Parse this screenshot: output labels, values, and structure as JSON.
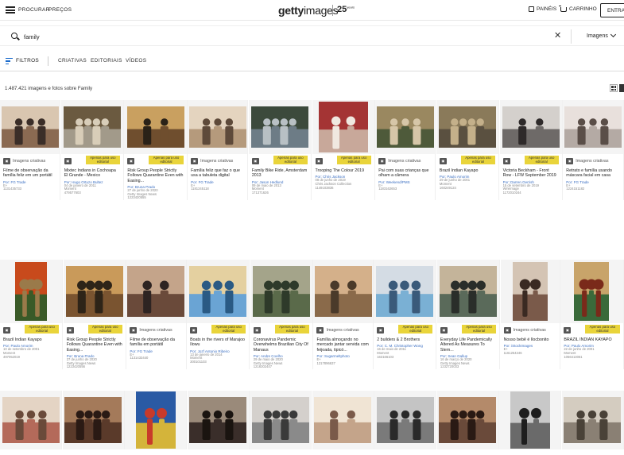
{
  "topbar": {
    "nav": [
      "PROCURAR",
      "PREÇOS"
    ],
    "logo_bold": "getty",
    "logo_thin": "images",
    "anniversary": "25",
    "anniversary_small": "years",
    "boards": "PAINÉIS",
    "cart": "CARRINHO",
    "login": "ENTRAR"
  },
  "search": {
    "value": "family",
    "type": "Imagens"
  },
  "filters": {
    "label": "FILTROS",
    "tabs": [
      "CRIATIVAS",
      "EDITORIAIS",
      "VÍDEOS"
    ]
  },
  "results": "1.487.421 imagens e fotos sobre Family",
  "badge_editorial": "Apenas para uso editorial",
  "badge_creative": "Imagens criativas",
  "cards_row1": [
    {
      "type": "creative",
      "title": "Filme de observação da família feliz em um portátil",
      "by": "Por: FG Trade",
      "meta": [
        "E+",
        "1131435733"
      ],
      "colors": [
        "#8a6a52",
        "#d9c6b0",
        "#3b2e28"
      ]
    },
    {
      "type": "editorial",
      "title": "Mixtec Indians in Cochoapa El Grande - Mexico",
      "by": "Por: Hugo Ortuzo Bultez",
      "meta": [
        "04 de janeiro de 2011",
        "Moment",
        "479577603"
      ],
      "colors": [
        "#a29a8a",
        "#6b5a40",
        "#d8cdb8"
      ]
    },
    {
      "type": "editorial",
      "title": "Risk Group People Strictly Follows Quarantine Even with Easing...",
      "by": "Por: Bruna Prado",
      "meta": [
        "27 de junho de 2020",
        "Getty Images News",
        "1223420555"
      ],
      "colors": [
        "#6f4e2e",
        "#c9a060",
        "#2a2218"
      ]
    },
    {
      "type": "creative",
      "title": "Família feliz que faz o que usa a tabuleta digital",
      "by": "Por: FG Trade",
      "meta": [
        "E+",
        "1181245118"
      ],
      "colors": [
        "#b59a7c",
        "#e4d4bf",
        "#5e4a3a"
      ]
    },
    {
      "type": "editorial",
      "title": "Family Bike Ride, Amsterdam 2013",
      "by": "Por: Jason Hedlund",
      "meta": [
        "09 de maio de 2013",
        "Moment",
        "171371626"
      ],
      "colors": [
        "#6d7c86",
        "#3c4a3c",
        "#b8c0c4"
      ]
    },
    {
      "type": "editorial",
      "title": "Trooping The Colour 2019",
      "by": "Por: Chris Jackson",
      "meta": [
        "08 de junho de 2019",
        "Chris Jackson Collection",
        "1149103836"
      ],
      "colors": [
        "#c8a89a",
        "#a43434",
        "#f0e8e0"
      ]
    },
    {
      "type": "creative",
      "title": "Pai com suas crianças que olham a câmera",
      "by": "Por: Weekend/PMS",
      "meta": [
        "E+",
        "1183162653"
      ],
      "colors": [
        "#4e5a3a",
        "#9a8860",
        "#d6c6a8"
      ]
    },
    {
      "type": "editorial",
      "title": "Brazil Indian Kayapo",
      "by": "Por: Paulo Amorim",
      "meta": [
        "29 de junho de 2001",
        "Moment",
        "160249124"
      ],
      "colors": [
        "#5a5040",
        "#8a7a5a",
        "#c4b08a"
      ]
    },
    {
      "type": "editorial",
      "title": "Victoria Beckham - Front Row - LFW September 2019",
      "by": "Por: Darren Gerrish",
      "meta": [
        "15 de setembro de 2019",
        "WireImage",
        "1172010244"
      ],
      "colors": [
        "#6e6a68",
        "#d4d0cc",
        "#2e2a2a"
      ]
    },
    {
      "type": "creative",
      "title": "Retrato e família usando máscara facial em casa",
      "by": "Por: FG Trade",
      "meta": [
        "E+",
        "1224151182"
      ],
      "colors": [
        "#b4aaa4",
        "#e8e0dc",
        "#5a4e48"
      ]
    }
  ],
  "cards_row2": [
    {
      "type": "editorial",
      "title": "Brazil Indian Kayapo",
      "by": "Por: Paulo Amorim",
      "meta": [
        "10 de setembro de 2001",
        "Moment",
        "497052019"
      ],
      "colors": [
        "#3a5a28",
        "#c84a1c",
        "#9a7a4a"
      ]
    },
    {
      "type": "editorial",
      "title": "Risk Group People Strictly Follows Quarantine Even with Easing...",
      "by": "Por: Bruna Prado",
      "meta": [
        "27 de junho de 2020",
        "Getty Images News",
        "1223420556"
      ],
      "colors": [
        "#7a5430",
        "#c99a5a",
        "#2e2418"
      ]
    },
    {
      "type": "creative",
      "title": "Filme de observação da família em portátil",
      "by": "Por: FG Trade",
      "meta": [
        "E+",
        "1131433440"
      ],
      "colors": [
        "#6a4a3a",
        "#c4a48a",
        "#2e2422"
      ]
    },
    {
      "type": "editorial",
      "title": "Boats in the rivers of Marajoo Ilowu",
      "by": "Por: Jozf Antonio Ribeiro",
      "meta": [
        "13 de janeiro de 2014",
        "Moment",
        "300101103"
      ],
      "colors": [
        "#6aa4d4",
        "#e4d0a0",
        "#2a5a84"
      ]
    },
    {
      "type": "editorial",
      "title": "Coronavirus Pandemic Overwhelms Brazilian City Of Manaus",
      "by": "Por: Andre Coelho",
      "meta": [
        "29 de maio de 2020",
        "Getty Images News",
        "1216302447"
      ],
      "colors": [
        "#5a6a4a",
        "#a4a48a",
        "#2e3a2a"
      ]
    },
    {
      "type": "creative",
      "title": "Família almoçando no mercado jantar servida com feijoada, tipicó...",
      "by": "Por: Sugarmeltphoto",
      "meta": [
        "E+",
        "1217896637"
      ],
      "colors": [
        "#8a6a4a",
        "#d4b08a",
        "#4a3a2a"
      ]
    },
    {
      "type": "editorial",
      "title": "2 builders & 2 Brothers",
      "by": "Por: C. M. Christopher Wong",
      "meta": [
        "16 de maio de 2011",
        "Moment",
        "163166103"
      ],
      "colors": [
        "#7ab0d4",
        "#d4dce4",
        "#3a5a7a"
      ]
    },
    {
      "type": "editorial",
      "title": "Everyday Life Pandemically Altered As Measures To Stem...",
      "by": "Por: Sean Gallup",
      "meta": [
        "16 de março de 2020",
        "Getty Images News",
        "1232720033"
      ],
      "colors": [
        "#5a6a5a",
        "#c4b49a",
        "#2a2e2a"
      ]
    },
    {
      "type": "creative",
      "title": "Nosso bebê é Ilocbonito",
      "by": "Por: iStockImages",
      "meta": [
        "E+",
        "1161254246"
      ],
      "colors": [
        "#7a5a4a",
        "#d4c4b4",
        "#3a2a22"
      ]
    },
    {
      "type": "editorial",
      "title": "BRAZIL INDIAN KAYAPO",
      "by": "Por: Paulo Amorim",
      "meta": [
        "22 de junho de 2001",
        "Moment",
        "1056413061"
      ],
      "colors": [
        "#3a6a3a",
        "#c8a46a",
        "#7a2a1a"
      ]
    }
  ],
  "cards_row3": [
    {
      "colors": [
        "#b46a5a",
        "#e4d4c4",
        "#6a4a3a"
      ]
    },
    {
      "colors": [
        "#5a3a2a",
        "#a47a5a",
        "#2a1a14"
      ]
    },
    {
      "colors": [
        "#d4b43a",
        "#2a5aa4",
        "#c83a2a"
      ]
    },
    {
      "colors": [
        "#3a2e2a",
        "#9a8a7a",
        "#1a1410"
      ]
    },
    {
      "colors": [
        "#8a8a8a",
        "#d4d0cc",
        "#3a3a3a"
      ]
    },
    {
      "colors": [
        "#c4a48a",
        "#f0e4d4",
        "#7a5a4a"
      ]
    },
    {
      "colors": [
        "#7a7a7a",
        "#c4c4c4",
        "#2a2a2a"
      ]
    },
    {
      "colors": [
        "#6a4a3a",
        "#b48a6a",
        "#2a1a14"
      ]
    },
    {
      "colors": [
        "#6a6a6a",
        "#c8c8c8",
        "#1e1e1e"
      ]
    },
    {
      "colors": [
        "#8a8074",
        "#d4ccc0",
        "#4a4238"
      ]
    }
  ]
}
